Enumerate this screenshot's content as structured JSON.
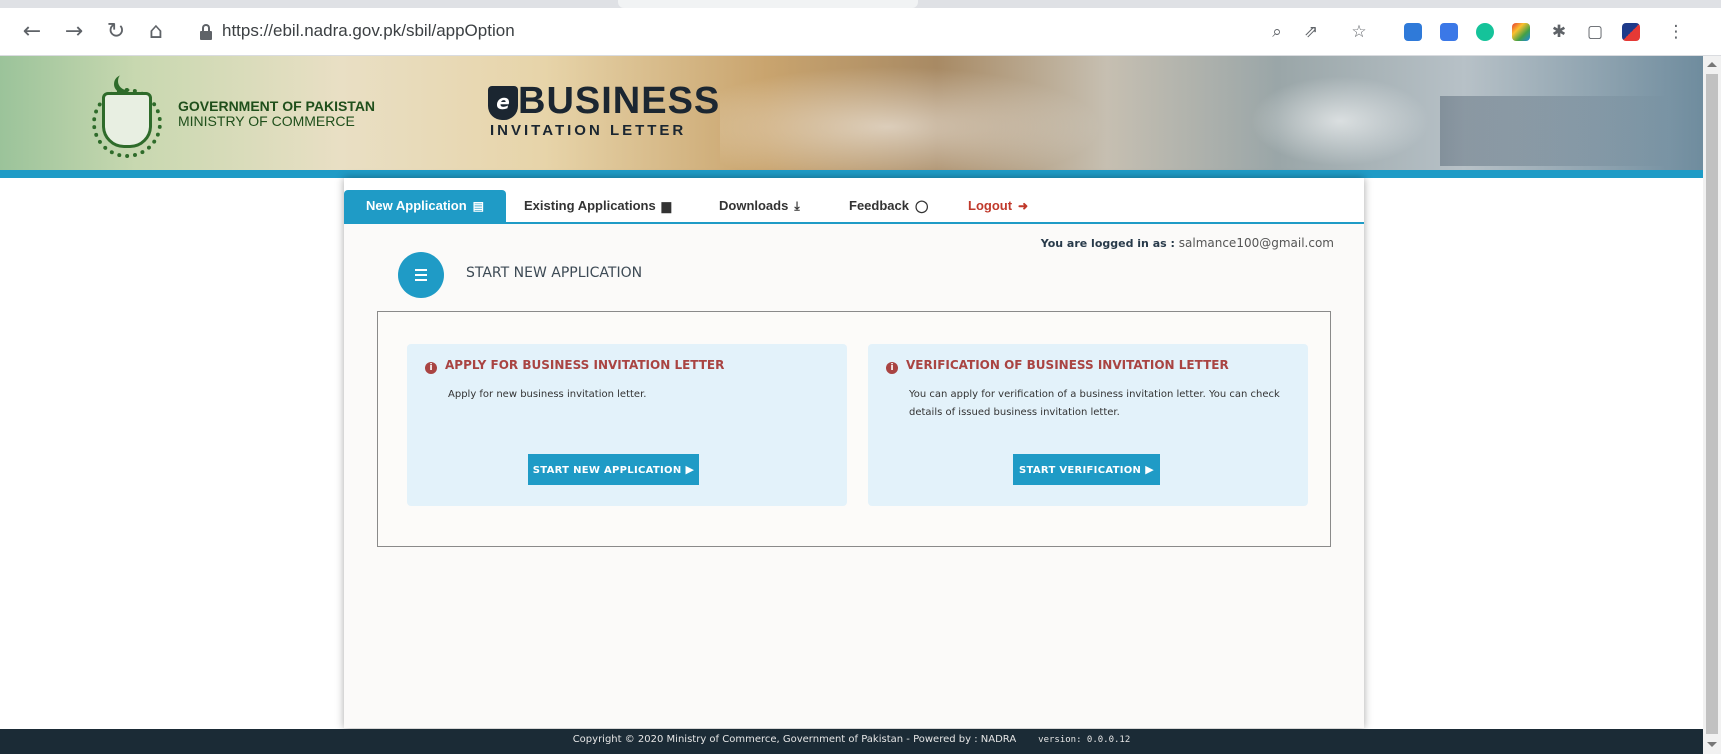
{
  "browser": {
    "url": "https://ebil.nadra.gov.pk/sbil/appOption",
    "icons": [
      "back-arrow-icon",
      "forward-arrow-icon",
      "reload-icon",
      "home-icon",
      "lock-icon",
      "zoom-icon",
      "share-icon",
      "bookmark-star-icon",
      "extensions-puzzle-icon",
      "sidebar-icon",
      "menu-dots-icon"
    ]
  },
  "banner": {
    "gov_line1": "GOVERNMENT OF PAKISTAN",
    "gov_line2": "MINISTRY OF COMMERCE",
    "logo_big": "BUSINESS",
    "logo_small": "INVITATION LETTER",
    "logo_badge": "e"
  },
  "tabs": [
    {
      "label": "New Application",
      "icon": "document-icon",
      "active": true
    },
    {
      "label": "Existing Applications",
      "icon": "briefcase-icon",
      "active": false
    },
    {
      "label": "Downloads",
      "icon": "download-icon",
      "active": false
    },
    {
      "label": "Feedback",
      "icon": "comment-icon",
      "active": false
    },
    {
      "label": "Logout",
      "icon": "sign-out-icon",
      "active": false
    }
  ],
  "user": {
    "prefix": "You are logged in as :",
    "email": "salmance100@gmail.com"
  },
  "page_title": "START NEW APPLICATION",
  "cards": [
    {
      "title": "APPLY FOR BUSINESS INVITATION LETTER",
      "description": "Apply for new business invitation letter.",
      "button": "START NEW APPLICATION"
    },
    {
      "title": "VERIFICATION OF BUSINESS INVITATION LETTER",
      "description": "You can apply for verification of a business invitation letter. You can check details of issued business invitation letter.",
      "button": "START VERIFICATION"
    }
  ],
  "footer": {
    "copyright": "Copyright © 2020 Ministry of Commerce, Government of Pakistan  - Powered by : NADRA",
    "version": "version: 0.0.0.12"
  },
  "colors": {
    "accent": "#1f9bc6",
    "alert": "#a94442",
    "footer_bg": "#1b2b36",
    "card_bg": "#e3f2fa"
  }
}
